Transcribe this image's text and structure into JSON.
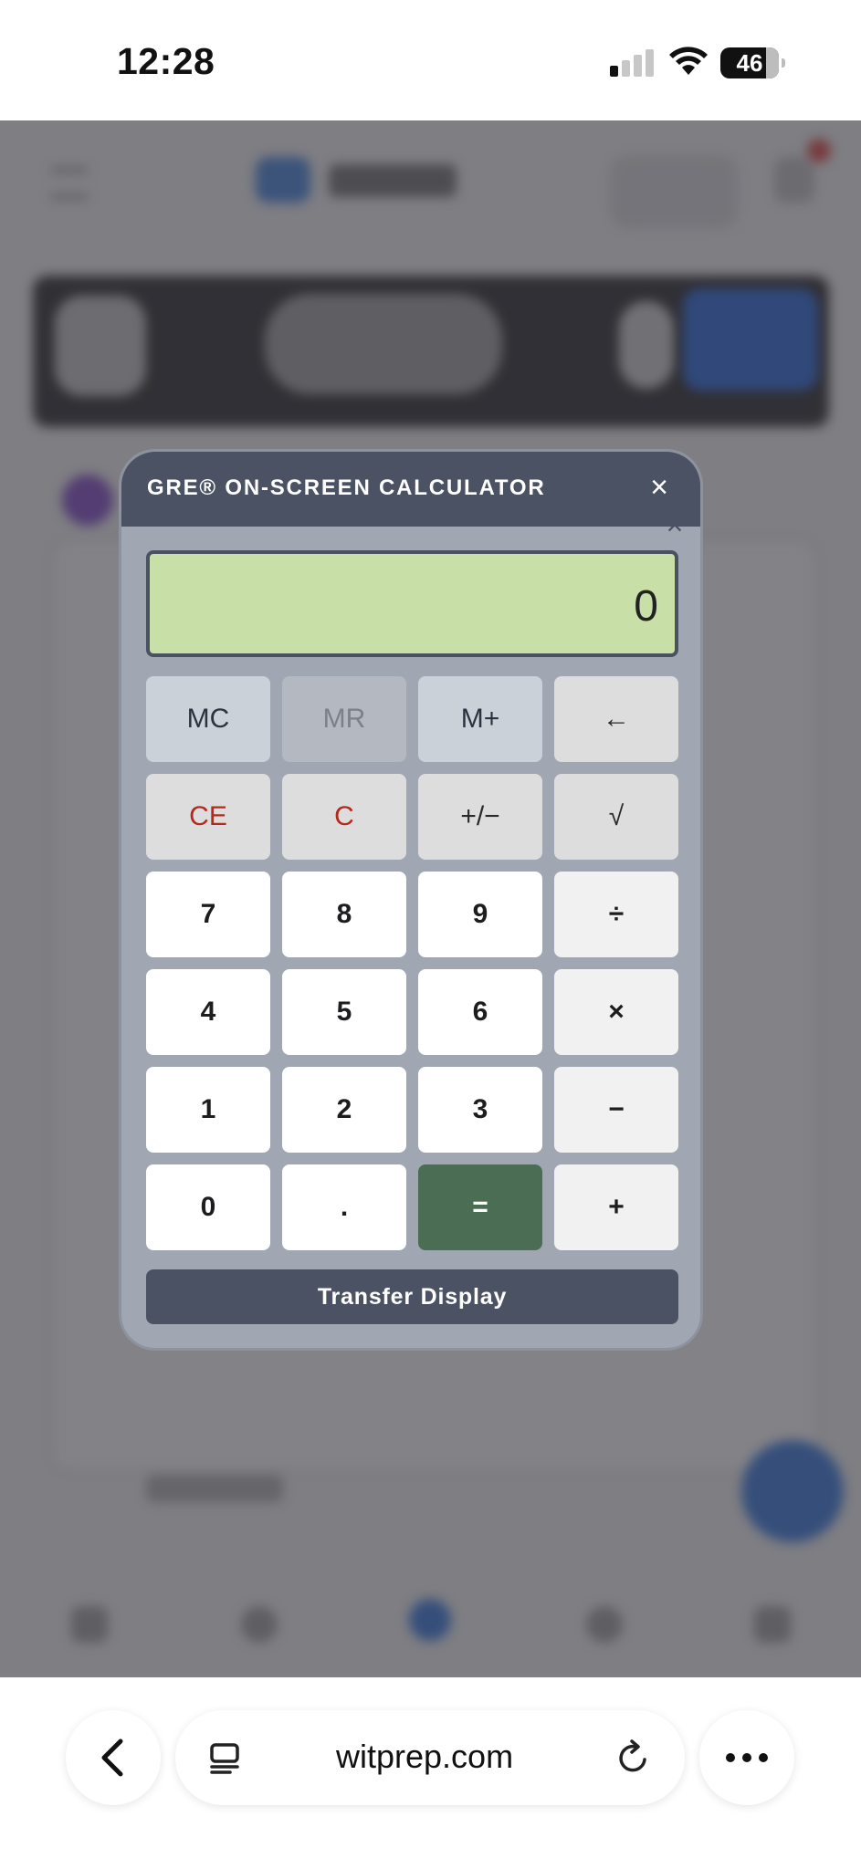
{
  "status_bar": {
    "time": "12:28",
    "battery": "46"
  },
  "calculator": {
    "title": "GRE® ON-SCREEN CALCULATOR",
    "close_symbol": "×",
    "display_value": "0",
    "keys": {
      "mc": "MC",
      "mr": "MR",
      "m_plus": "M+",
      "backspace": "←",
      "ce": "CE",
      "c": "C",
      "plus_minus": "+/−",
      "sqrt": "√",
      "seven": "7",
      "eight": "8",
      "nine": "9",
      "divide": "÷",
      "four": "4",
      "five": "5",
      "six": "6",
      "multiply": "×",
      "one": "1",
      "two": "2",
      "three": "3",
      "minus": "−",
      "zero": "0",
      "decimal": ".",
      "equals": "=",
      "plus": "+"
    },
    "transfer_label": "Transfer Display"
  },
  "browser": {
    "url": "witprep.com"
  },
  "colors": {
    "header": "#4b5263",
    "display": "#c8e0a8",
    "equals": "#4a6d54",
    "clear_text": "#b5281c"
  }
}
